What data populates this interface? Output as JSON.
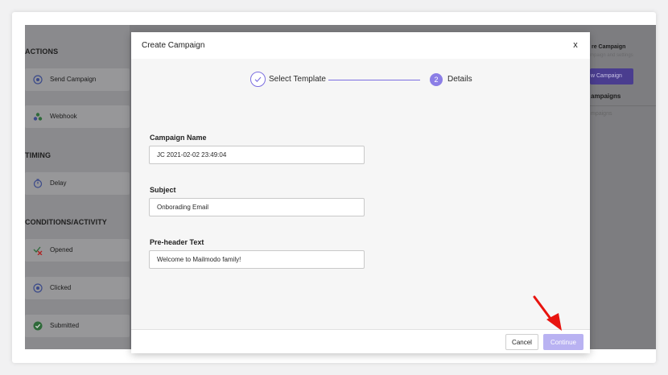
{
  "sidebar": {
    "sections": [
      {
        "title": "ACTIONS"
      },
      {
        "title": "TIMING"
      },
      {
        "title": "CONDITIONS/ACTIVITY"
      }
    ],
    "items": [
      {
        "label": "Send Campaign",
        "icon": "send-campaign-icon"
      },
      {
        "label": "Webhook",
        "icon": "webhook-icon"
      },
      {
        "label": "Delay",
        "icon": "timer-icon"
      },
      {
        "label": "Opened",
        "icon": "opened-icon"
      },
      {
        "label": "Clicked",
        "icon": "clicked-icon"
      },
      {
        "label": "Submitted",
        "icon": "check-circle-icon"
      }
    ]
  },
  "right_panel": {
    "title": "re Campaign",
    "subtitle": "mpaign and settings",
    "button_label": "w Campaign",
    "section_title": "ampaigns",
    "placeholder": "mpaigns"
  },
  "modal": {
    "title": "Create Campaign",
    "close_label": "x",
    "steps": [
      {
        "label": "Select Template",
        "state": "completed"
      },
      {
        "number": "2",
        "label": "Details",
        "state": "active"
      }
    ],
    "fields": {
      "campaign_name": {
        "label": "Campaign Name",
        "value": "JC 2021-02-02 23:49:04"
      },
      "subject": {
        "label": "Subject",
        "value": "Onborading Email"
      },
      "preheader": {
        "label": "Pre-header Text",
        "value": "Welcome to Mailmodo family!"
      }
    },
    "footer": {
      "cancel_label": "Cancel",
      "continue_label": "Continue"
    }
  },
  "colors": {
    "accent": "#8b7ee6",
    "continue_button": "#b9b2f2",
    "annotation_arrow": "#e8140f"
  }
}
